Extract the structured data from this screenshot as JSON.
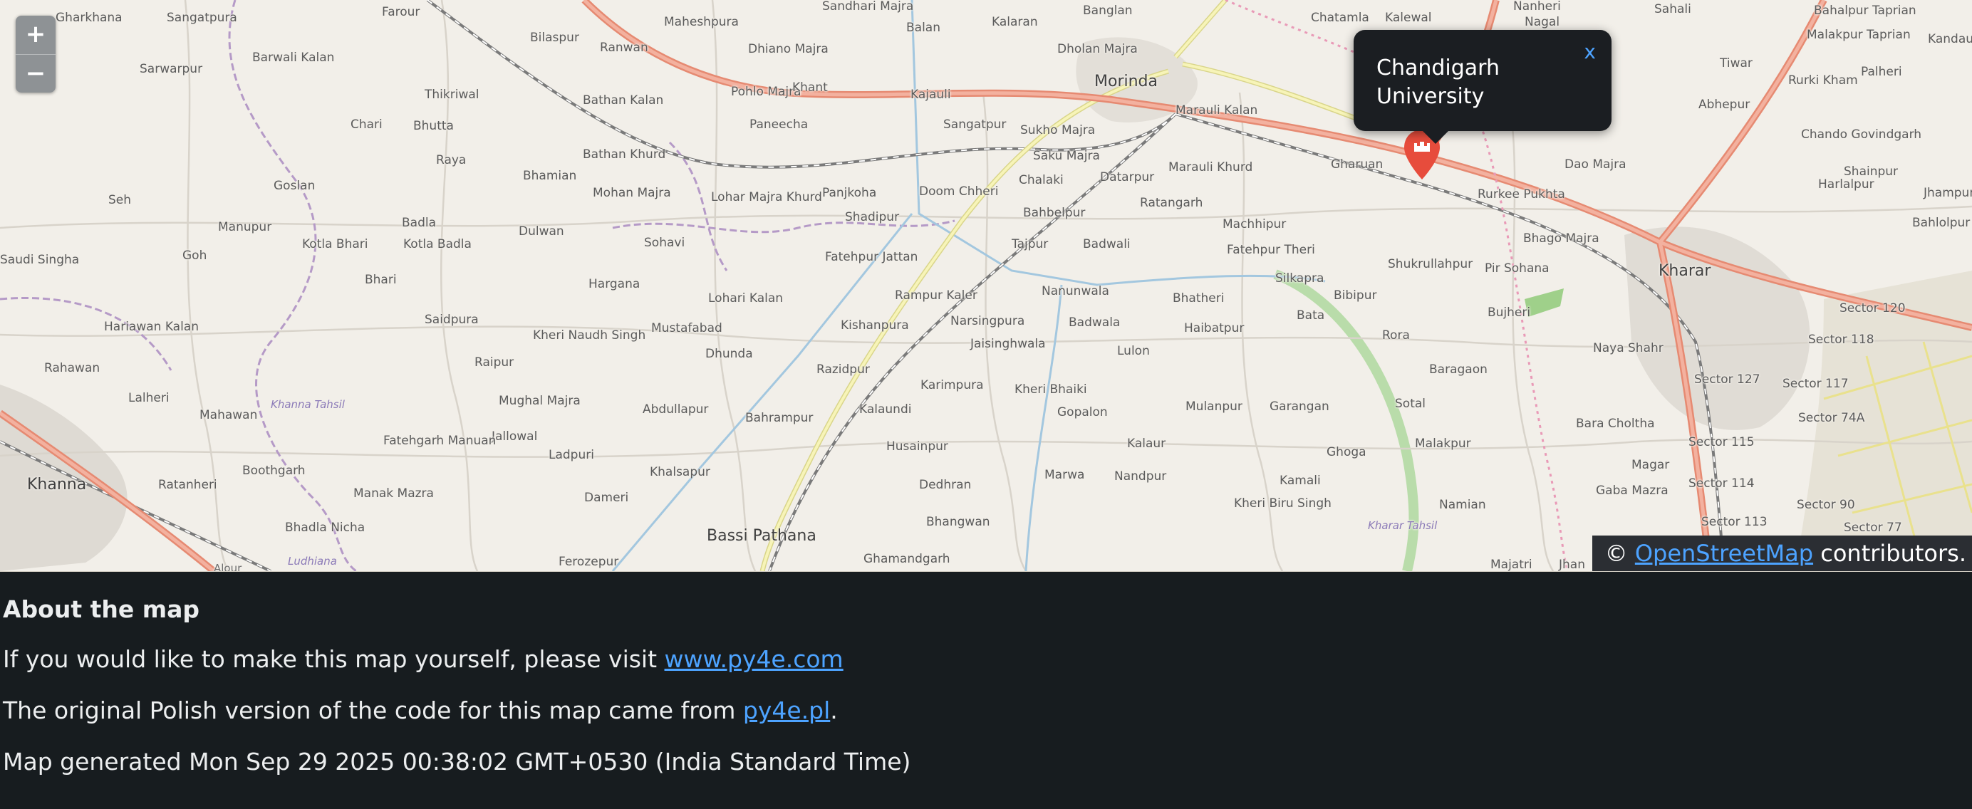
{
  "map": {
    "zoom_in_label": "+",
    "zoom_out_label": "−",
    "popup": {
      "title": "Chandigarh University",
      "close_label": "x"
    },
    "attribution": {
      "prefix": "© ",
      "link_text": "OpenStreetMap",
      "suffix": " contributors."
    },
    "places": [
      "Gharkhana",
      "Sangatpura",
      "Farour",
      "Maheshpura",
      "Sandhari Majra",
      "Balan",
      "Kalaran",
      "Banglan",
      "Chatamla",
      "Kalewal",
      "Nanheri",
      "Nagal",
      "Sahali",
      "Bahalpur Taprian",
      "Malakpur Taprian",
      "Kandauli",
      "Palheri",
      "Tiwar",
      "Rurki Kham",
      "Sarwarpur",
      "Barwali Kalan",
      "Bilaspur",
      "Ranwan",
      "Dhiano Majra",
      "Dholan Majra",
      "Morinda",
      "Pohlo Majra",
      "Khant",
      "Kajauli",
      "Sangatpur",
      "Sukho Majra",
      "Marauli Kalan",
      "Abhepur",
      "Chando Govindgarh",
      "Thikriwal",
      "Chari",
      "Bhutta",
      "Bathan Kalan",
      "Paneecha",
      "Saku Majra",
      "Marauli Khurd",
      "Gharuan",
      "Dao Majra",
      "Shainpur",
      "Raya",
      "Bathan Khurd",
      "Chalaki",
      "Datarpur",
      "Harlalpur",
      "Jhampur",
      "Bhamian",
      "Seh",
      "Goslan",
      "Mohan Majra",
      "Lohar Majra Khurd",
      "Panjkoha",
      "Doom Chheri",
      "Ratangarh",
      "Rurkee Pukhta",
      "Manupur",
      "Badla",
      "Dulwan",
      "Shadipur",
      "Bahbelpur",
      "Machhipur",
      "Bhago Majra",
      "Bahlolpur",
      "Saudi Singha",
      "Goh",
      "Kotla Bhari",
      "Kotla Badla",
      "Sohavi",
      "Fatehpur Jattan",
      "Tajpur",
      "Badwali",
      "Fatehpur Theri",
      "Shukrullahpur",
      "Pir Sohana",
      "Kharar",
      "Bhari",
      "Hargana",
      "Lohari Kalan",
      "Rampur Kaler",
      "Nanunwala",
      "Bhatheri",
      "Silkapra",
      "Bibipur",
      "Bujheri",
      "Sector 120",
      "Hariawan Kalan",
      "Saidpura",
      "Kheri Naudh Singh",
      "Mustafabad",
      "Kishanpura",
      "Narsingpura",
      "Badwala",
      "Haibatpur",
      "Bata",
      "Rora",
      "Naya Shahr",
      "Sector 118",
      "Rahawan",
      "Raipur",
      "Dhunda",
      "Jaisinghwala",
      "Lulon",
      "Razidpur",
      "Baragaon",
      "Sector 127",
      "Sector 117",
      "Lalheri",
      "Mughal Majra",
      "Abdullapur",
      "Karimpura",
      "Kheri Bhaiki",
      "Mulanpur",
      "Garangan",
      "Sotal",
      "Bara Choltha",
      "Sector 74A",
      "Mahawan",
      "Jallowal",
      "Bahrampur",
      "Kalaundi",
      "Gopalon",
      "Fatehgarh Manuan",
      "Ladpuri",
      "Husainpur",
      "Kalaur",
      "Ghoga",
      "Malakpur",
      "Sector 115",
      "Magar",
      "Khanna",
      "Ratanheri",
      "Boothgarh",
      "Khalsapur",
      "Marwa",
      "Nandpur",
      "Kamali",
      "Sector 114",
      "Gaba Mazra",
      "Manak Mazra",
      "Dameri",
      "Dedhran",
      "Kheri Biru Singh",
      "Namian",
      "Sector 90",
      "Bhadla Nicha",
      "Bhangwan",
      "Sector 113",
      "Sector 77",
      "Bassi Pathana",
      "Ferozepur",
      "Ghamandgarh",
      "Majatri",
      "Jhan",
      "Alour",
      "Ludhiana",
      "Khanna Tahsil",
      "Kharar Tahsil"
    ]
  },
  "about": {
    "heading": "About the map",
    "line1_text": "If you would like to make this map yourself, please visit ",
    "line1_link": "www.py4e.com",
    "line2_text": "The original Polish version of the code for this map came from ",
    "line2_link": "py4e.pl",
    "line2_suffix": ".",
    "line3": "Map generated Mon Sep 29 2025 00:38:02 GMT+0530 (India Standard Time)"
  },
  "colors": {
    "page_background": "#171c1f",
    "map_land": "#f2efe9",
    "primary_road": "#e8927c",
    "secondary_road": "#f0ed9b",
    "railway": "#707070",
    "canal": "#a3c7df",
    "marker": "#e74c3c",
    "link": "#4da3ff"
  }
}
